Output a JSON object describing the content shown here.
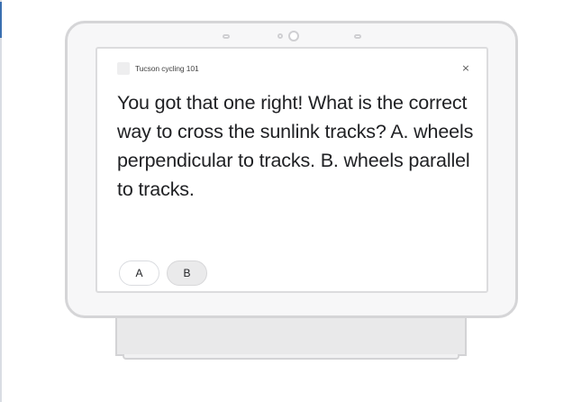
{
  "app": {
    "title": "Tucson cycling 101",
    "close_label": "×"
  },
  "message": {
    "text": "You got that one right! What is the correct way to cross the sunlink tracks? A. wheels perpendicular to tracks. B. wheels parallel to tracks."
  },
  "suggestions": [
    {
      "label": "A",
      "selected": false
    },
    {
      "label": "B",
      "selected": true
    }
  ],
  "icons": {
    "app": "app-logo-icon",
    "close": "close-icon"
  },
  "colors": {
    "text": "#202124",
    "frame": "#d5d5d7",
    "chip_border": "#dadce0",
    "chip_selected": "#eaeaeb"
  }
}
